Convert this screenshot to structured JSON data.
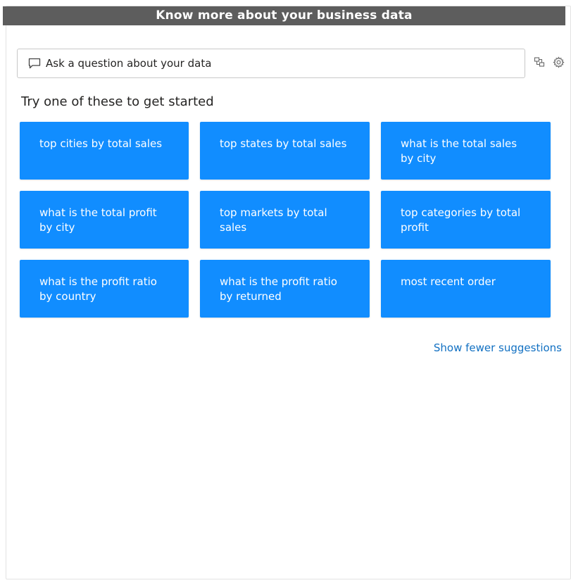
{
  "banner": {
    "title": "Know more about your business data"
  },
  "qa": {
    "placeholder": "Ask a question about your data",
    "value": "",
    "icons": {
      "input": "chat-bubble-icon",
      "tool1": "synonyms-icon",
      "tool2": "settings-gear-icon"
    }
  },
  "suggestions": {
    "heading": "Try one of these to get started",
    "items": [
      {
        "label": "top cities by total sales"
      },
      {
        "label": "top states by total sales"
      },
      {
        "label": "what is the total sales by city"
      },
      {
        "label": "what is the total profit by city"
      },
      {
        "label": "top markets by total sales"
      },
      {
        "label": "top categories by total profit"
      },
      {
        "label": "what is the profit ratio by country"
      },
      {
        "label": "what is the profit ratio by returned"
      },
      {
        "label": "most recent order"
      }
    ],
    "toggle_label": "Show fewer suggestions"
  },
  "colors": {
    "banner_bg": "#5d5d5d",
    "card_bg": "#118dff",
    "link": "#1170c2",
    "text": "#252423"
  }
}
